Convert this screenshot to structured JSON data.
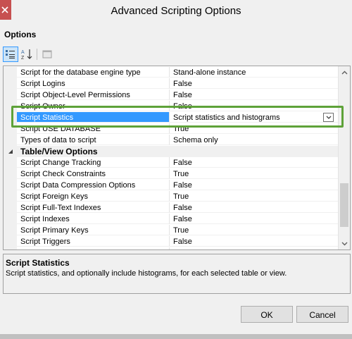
{
  "window": {
    "title": "Advanced Scripting Options"
  },
  "section_label": "Options",
  "toolbar": {
    "categorized_icon": "categorized-view-icon",
    "alphabetical_icon": "alphabetical-sort-icon",
    "pages_icon": "property-pages-icon"
  },
  "rows": [
    {
      "name": "Script for the database engine type",
      "value": "Stand-alone instance"
    },
    {
      "name": "Script Logins",
      "value": "False"
    },
    {
      "name": "Script Object-Level Permissions",
      "value": "False"
    },
    {
      "name": "Script Owner",
      "value": "False"
    },
    {
      "name": "Script Statistics",
      "value": "Script statistics and histograms",
      "selected": true
    },
    {
      "name": "Script USE DATABASE",
      "value": "True"
    },
    {
      "name": "Types of data to script",
      "value": "Schema only"
    },
    {
      "category": "Table/View Options"
    },
    {
      "name": "Script Change Tracking",
      "value": "False"
    },
    {
      "name": "Script Check Constraints",
      "value": "True"
    },
    {
      "name": "Script Data Compression Options",
      "value": "False"
    },
    {
      "name": "Script Foreign Keys",
      "value": "True"
    },
    {
      "name": "Script Full-Text Indexes",
      "value": "False"
    },
    {
      "name": "Script Indexes",
      "value": "False"
    },
    {
      "name": "Script Primary Keys",
      "value": "True"
    },
    {
      "name": "Script Triggers",
      "value": "False"
    },
    {
      "name": "Script Unique Keys",
      "value": "True"
    }
  ],
  "description": {
    "title": "Script Statistics",
    "text": "Script statistics, and optionally include histograms, for each selected table or view."
  },
  "buttons": {
    "ok": "OK",
    "cancel": "Cancel"
  },
  "colors": {
    "selection": "#3399ff",
    "highlight": "#5ea239"
  }
}
